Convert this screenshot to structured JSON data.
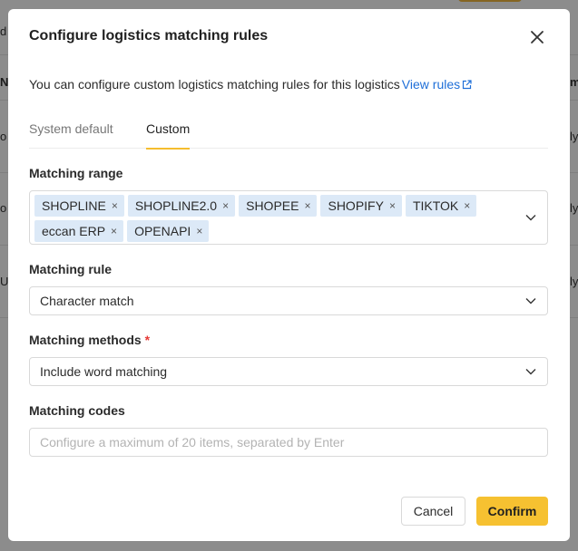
{
  "background": {
    "fragments": [
      "d",
      "N",
      "o",
      "o",
      "U",
      "m",
      "ly",
      "ly",
      "ly"
    ]
  },
  "modal": {
    "title": "Configure logistics matching rules",
    "description": "You can configure custom logistics matching rules for this logistics",
    "view_rules_link": "View rules",
    "tabs": [
      {
        "label": "System default",
        "active": false
      },
      {
        "label": "Custom",
        "active": true
      }
    ],
    "matching_range": {
      "label": "Matching range",
      "tags_row1": [
        "SHOPLINE",
        "SHOPLINE2.0",
        "SHOPEE",
        "SHOPIFY",
        "TIKTOK"
      ],
      "tags_row2": [
        "eccan ERP",
        "OPENAPI"
      ]
    },
    "matching_rule": {
      "label": "Matching rule",
      "value": "Character match"
    },
    "matching_methods": {
      "label": "Matching methods",
      "required_mark": "*",
      "value": "Include word matching"
    },
    "matching_codes": {
      "label": "Matching codes",
      "placeholder": "Configure a maximum of 20 items, separated by Enter",
      "value": ""
    },
    "buttons": {
      "cancel": "Cancel",
      "confirm": "Confirm"
    }
  },
  "colors": {
    "accent": "#f6c131",
    "link": "#1f6fd8",
    "tag_bg": "#dce9f7",
    "required": "#e53935"
  }
}
